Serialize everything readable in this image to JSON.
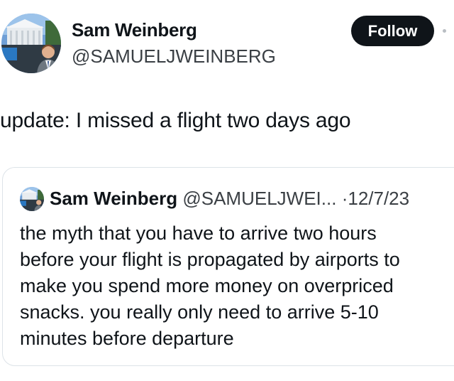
{
  "post": {
    "author_name": "Sam Weinberg",
    "author_handle": "@SAMUELJWEINBERG",
    "follow_label": "Follow",
    "text": "update: I missed a flight two days ago"
  },
  "quoted_post": {
    "author_name": "Sam Weinberg",
    "author_handle": "@SAMUELJWEI...",
    "separator": "·",
    "date": "12/7/23",
    "text": "the myth that you have to arrive two hours\nbefore your flight is propagated by airports to\nmake you spend more money on overpriced\nsnacks. you really only need to arrive 5-10\nminutes before departure"
  },
  "icons": {
    "avatar": "profile-photo",
    "more": "more-options-icon"
  },
  "colors": {
    "follow_button_bg": "#0f1419",
    "follow_button_text": "#ffffff",
    "primary_text": "#0f1419",
    "secondary_text": "#3a3f44",
    "card_border": "#dde3e8"
  }
}
